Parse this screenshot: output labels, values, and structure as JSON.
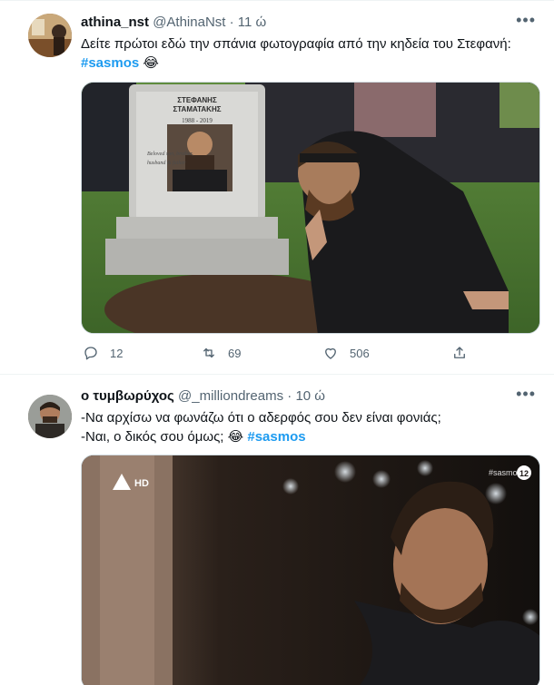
{
  "tweets": [
    {
      "display_name": "athina_nst",
      "handle": "@AthinaNst",
      "separator": "·",
      "time": "11 ώ",
      "text": "Δείτε πρώτοι εδώ την σπάνια φωτογραφία από την κηδεία του Στεφανή:",
      "hashtag": "#sasmos",
      "emoji": "😂",
      "media": {
        "tombstone_line1": "ΣΤΕΦΑΝΗΣ",
        "tombstone_line2": "ΣΤΑΜΑΤΑΚΗΣ",
        "tombstone_years": "1988 - 2019",
        "tombstone_epitaph1": "Beloved son, brother,",
        "tombstone_epitaph2": "husband & father"
      },
      "actions": {
        "replies": "12",
        "retweets": "69",
        "likes": "506"
      }
    },
    {
      "display_name": "ο τυμβωρύχος",
      "handle": "@_milliondreams",
      "separator": "·",
      "time": "10 ώ",
      "line1": "-Να αρχίσω να φωνάζω ότι ο αδερφός σου δεν είναι φονιάς;",
      "line2": "-Ναι, ο δικός σου όμως;",
      "emoji": "😂",
      "hashtag": "#sasmos",
      "media": {
        "channel_logo": "HD",
        "watermark_tag": "#sasmos",
        "rating": "12"
      }
    }
  ],
  "more_icon": "more-horizontal-icon"
}
